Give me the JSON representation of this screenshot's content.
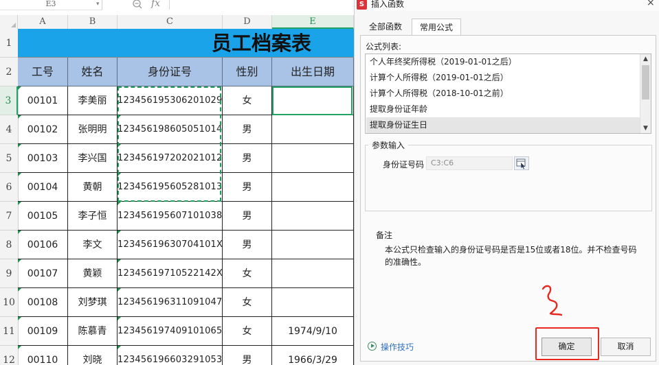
{
  "sheet": {
    "name_box": "E3",
    "columns": [
      "A",
      "B",
      "C",
      "D",
      "E"
    ],
    "active_column": "E",
    "rows": [
      "1",
      "2",
      "3",
      "4",
      "5",
      "6",
      "7",
      "8",
      "9",
      "10",
      "11",
      "12"
    ],
    "active_row": "3",
    "title": "员工档案表",
    "headers": [
      "工号",
      "姓名",
      "身份证号",
      "性别",
      "出生日期"
    ],
    "data": [
      [
        "00101",
        "李美丽",
        "123456195306201029",
        "女",
        ""
      ],
      [
        "00102",
        "张明明",
        "123456198605051014",
        "男",
        ""
      ],
      [
        "00103",
        "李兴国",
        "123456197202021012",
        "男",
        ""
      ],
      [
        "00104",
        "黄朝",
        "123456195605281013",
        "男",
        ""
      ],
      [
        "00105",
        "李子恒",
        "123456195607101038",
        "男",
        ""
      ],
      [
        "00106",
        "李文",
        "12345619630704101X",
        "男",
        ""
      ],
      [
        "00107",
        "黄颖",
        "12345619710522142X",
        "女",
        ""
      ],
      [
        "00108",
        "刘梦琪",
        "123456196311091047",
        "女",
        ""
      ],
      [
        "00109",
        "陈慕青",
        "123456197409101065",
        "女",
        "1974/9/10"
      ],
      [
        "00110",
        "刘晓",
        "123456196603291053",
        "男",
        "1966/3/29"
      ]
    ]
  },
  "dialog": {
    "logo_letter": "S",
    "title": "插入函数",
    "close_glyph": "×",
    "tabs": [
      {
        "label": "全部函数",
        "active": false
      },
      {
        "label": "常用公式",
        "active": true
      }
    ],
    "list_label": "公式列表:",
    "formulas": [
      {
        "label": "个人年终奖所得税（2019-01-01之后）",
        "selected": false
      },
      {
        "label": "计算个人所得税（2019-01-01之后）",
        "selected": false
      },
      {
        "label": "计算个人所得税（2018-10-01之前）",
        "selected": false
      },
      {
        "label": "提取身份证年龄",
        "selected": false
      },
      {
        "label": "提取身份证生日",
        "selected": true
      }
    ],
    "params_title": "参数输入",
    "param_label": "身份证号码",
    "param_value": "C3:C6",
    "note_label": "备注",
    "note_text": "本公式只检查输入的身份证号码是否是15位或者18位。并不检查号码的准确性。",
    "tips_link": "操作技巧",
    "ok_label": "确定",
    "cancel_label": "取消",
    "annotation_color": "#e8271e",
    "accent": "#21a366",
    "title_fill": "#1aa3e8",
    "header_fill": "#a9c3e6"
  }
}
